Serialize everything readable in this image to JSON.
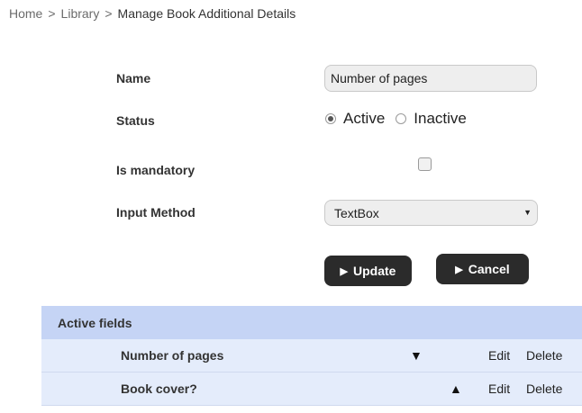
{
  "breadcrumb": {
    "items": [
      "Home",
      "Library",
      "Manage Book Additional Details"
    ],
    "separator": ">"
  },
  "form": {
    "name_label": "Name",
    "name_value": "Number of pages",
    "status_label": "Status",
    "status_options": [
      "Active",
      "Inactive"
    ],
    "status_selected": "Active",
    "mandatory_label": "Is mandatory",
    "mandatory_checked": false,
    "input_method_label": "Input Method",
    "input_method_value": "TextBox"
  },
  "buttons": {
    "update_label": "Update",
    "cancel_label": "Cancel"
  },
  "table": {
    "header": "Active fields",
    "rows": [
      {
        "name": "Number of pages",
        "arrow": "▼",
        "edit": "Edit",
        "delete": "Delete"
      },
      {
        "name": "Book cover?",
        "arrow": "▲",
        "edit": "Edit",
        "delete": "Delete"
      }
    ]
  },
  "icons": {
    "play": "play-triangle-icon",
    "caret": "caret-down-icon",
    "move_down": "arrow-down-icon",
    "move_up": "arrow-up-icon"
  }
}
